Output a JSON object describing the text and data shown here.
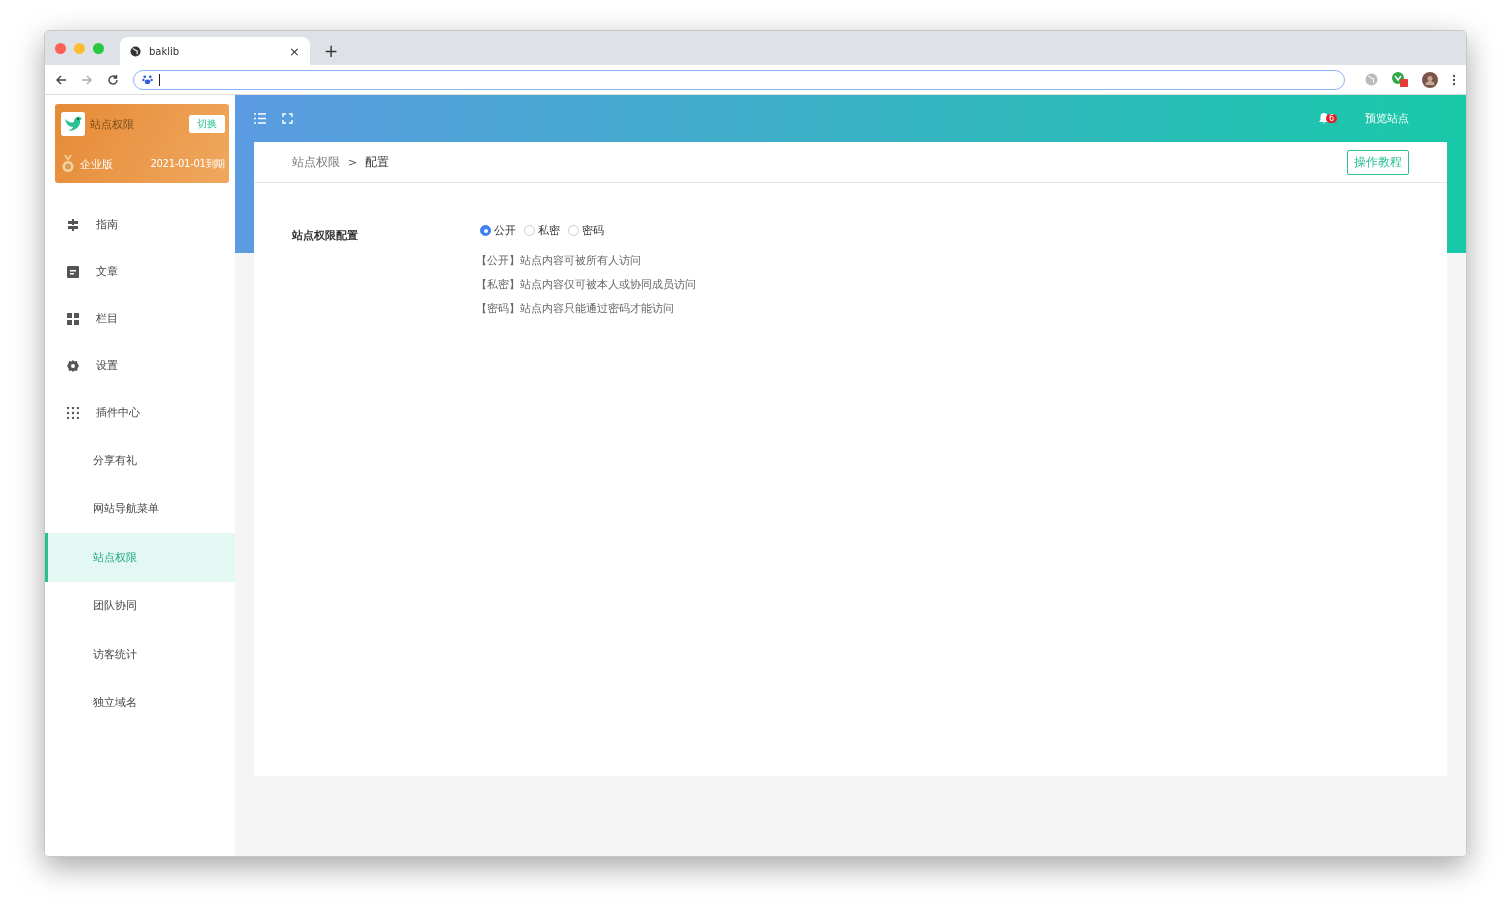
{
  "browser": {
    "tab_title": "baklib",
    "tab_close": "×",
    "new_tab": "+"
  },
  "sidebar": {
    "site": {
      "name": "站点权限",
      "switch_label": "切换",
      "plan": "企业版",
      "expiry": "2021-01-01到期"
    },
    "items": [
      {
        "label": "指南",
        "kind": "section",
        "selected": false
      },
      {
        "label": "文章",
        "kind": "section",
        "selected": false
      },
      {
        "label": "栏目",
        "kind": "section",
        "selected": false
      },
      {
        "label": "设置",
        "kind": "section",
        "selected": false
      },
      {
        "label": "插件中心",
        "kind": "section",
        "selected": false
      },
      {
        "label": "分享有礼",
        "kind": "sub",
        "selected": false
      },
      {
        "label": "网站导航菜单",
        "kind": "sub",
        "selected": false
      },
      {
        "label": "站点权限",
        "kind": "sub",
        "selected": true
      },
      {
        "label": "团队协同",
        "kind": "sub",
        "selected": false
      },
      {
        "label": "访客统计",
        "kind": "sub",
        "selected": false
      },
      {
        "label": "独立域名",
        "kind": "sub",
        "selected": false
      }
    ]
  },
  "header": {
    "notification_count": "6",
    "preview_label": "预览站点"
  },
  "breadcrumb": {
    "items": [
      "站点权限",
      "配置"
    ],
    "separator": ">"
  },
  "tutorial_button": "操作教程",
  "form": {
    "label": "站点权限配置",
    "options": [
      {
        "label": "公开",
        "selected": true
      },
      {
        "label": "私密",
        "selected": false
      },
      {
        "label": "密码",
        "selected": false
      }
    ],
    "descriptions": [
      "【公开】站点内容可被所有人访问",
      "【私密】站点内容仅可被本人或协同成员访问",
      "【密码】站点内容只能通过密码才能访问"
    ]
  }
}
